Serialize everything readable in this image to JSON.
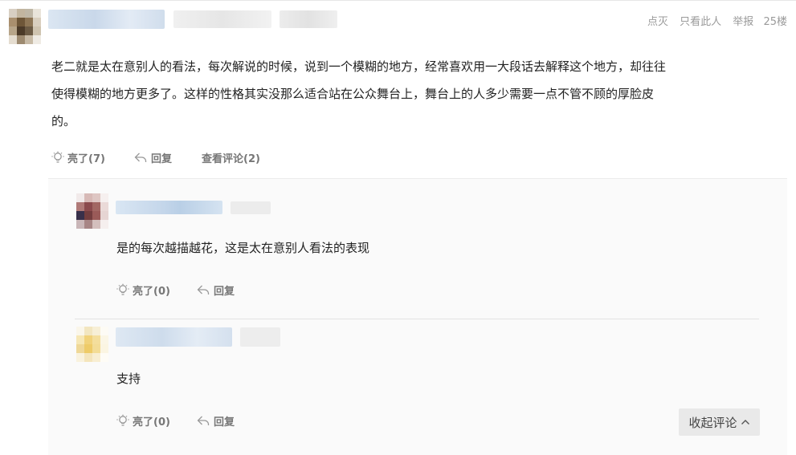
{
  "post": {
    "floor_actions": {
      "dim_label": "点灭",
      "only_author_label": "只看此人",
      "report_label": "举报",
      "floor_number": "25楼"
    },
    "content": "老二就是太在意别人的看法，每次解说的时候，说到一个模糊的地方，经常喜欢用一大段话去解释这个地方，却往往使得模糊的地方更多了。这样的性格其实没那么适合站在公众舞台上，舞台上的人多少需要一点不管不顾的厚脸皮的。",
    "actions": {
      "like_label": "亮了(7)",
      "reply_label": "回复",
      "view_comments_label": "查看评论(2)"
    }
  },
  "replies": [
    {
      "content": "是的每次越描越花，这是太在意别人看法的表现",
      "like_label": "亮了(0)",
      "reply_label": "回复"
    },
    {
      "content": "支持",
      "like_label": "亮了(0)",
      "reply_label": "回复"
    }
  ],
  "collapse_label": "收起评论",
  "colors": {
    "meta_gray": "#9a9a9a",
    "reply_bg": "#fafafa",
    "button_bg": "#e9e9e9"
  },
  "icons": {
    "like": "lightbulb-icon",
    "reply": "reply-arrow-icon",
    "collapse": "chevron-up-icon"
  }
}
